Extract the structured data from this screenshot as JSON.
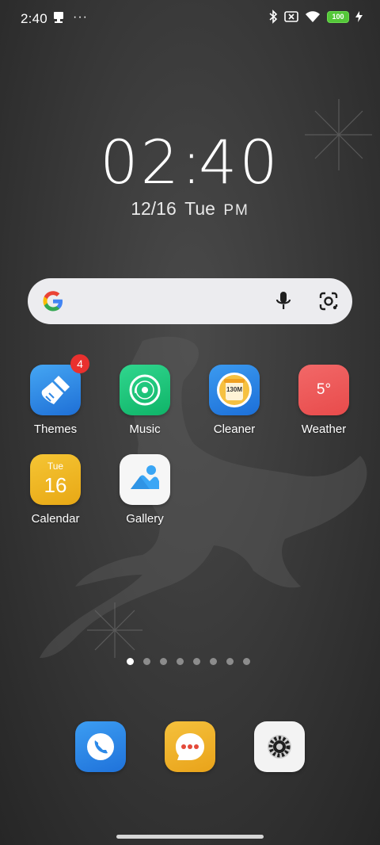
{
  "status_bar": {
    "time": "2:40",
    "more": "···",
    "battery_level": "100"
  },
  "clock": {
    "hours": "02",
    "minutes": "40",
    "separator": ":"
  },
  "date": {
    "day": "12/16",
    "weekday": "Tue",
    "period": "PM"
  },
  "apps": [
    {
      "label": "Themes",
      "badge": "4"
    },
    {
      "label": "Music"
    },
    {
      "label": "Cleaner",
      "icon_text": "130M"
    },
    {
      "label": "Weather",
      "icon_text": "5°"
    },
    {
      "label": "Calendar",
      "icon_weekday": "Tue",
      "icon_day": "16"
    },
    {
      "label": "Gallery"
    }
  ],
  "page_indicator": {
    "count": 8,
    "active": 0
  },
  "colors": {
    "themes": "#2f87e5",
    "music": "#17c47a",
    "cleaner": "#2b8be8",
    "weather": "#ef5a5a",
    "calendar": "#f2b622",
    "gallery": "#f5f5f5",
    "phone": "#2d8ae8",
    "messages": "#f2b330",
    "settings": "#f2f2f2"
  }
}
